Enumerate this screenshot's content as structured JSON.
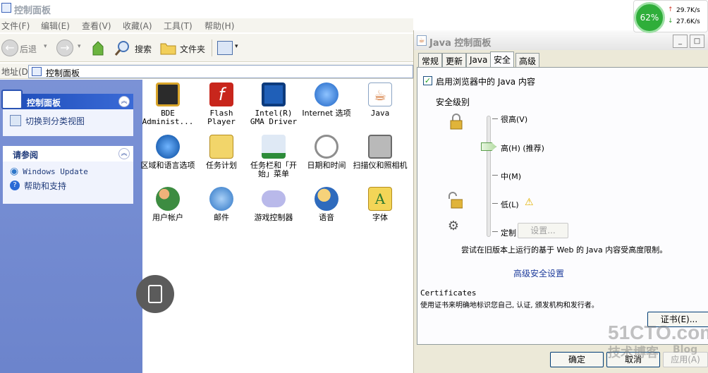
{
  "explorer": {
    "title": "控制面板",
    "menu": [
      "文件(F)",
      "编辑(E)",
      "查看(V)",
      "收藏(A)",
      "工具(T)",
      "帮助(H)"
    ],
    "toolbar": {
      "back_label": "后退",
      "search_label": "搜索",
      "folders_label": "文件夹"
    },
    "address": {
      "label": "地址(D)",
      "value": "控制面板"
    },
    "sidebar": {
      "panel1_title": "控制面板",
      "switch_view": "切换到分类视图",
      "panel2_title": "请参阅",
      "links": [
        "Windows Update",
        "帮助和支持"
      ]
    },
    "items": [
      {
        "label": "BDE Administ...",
        "icon": "bde-admin-icon",
        "color": "#d9a52a"
      },
      {
        "label": "Flash Player",
        "icon": "flash-icon",
        "color": "#c8261c"
      },
      {
        "label": "Intel(R) GMA Driver",
        "icon": "intel-gma-icon",
        "color": "#1f5fb8"
      },
      {
        "label": "Internet 选项",
        "icon": "internet-options-icon",
        "color": "#3d7fd6"
      },
      {
        "label": "Java",
        "icon": "java-icon",
        "color": "#cf6a24"
      },
      {
        "label": "区域和语言选项",
        "icon": "globe-icon",
        "color": "#2d76c9"
      },
      {
        "label": "任务计划",
        "icon": "scheduled-tasks-icon",
        "color": "#e2c04c"
      },
      {
        "label": "任务栏和「开始」菜单",
        "icon": "taskbar-icon",
        "color": "#2d8c3a"
      },
      {
        "label": "日期和时间",
        "icon": "clock-icon",
        "color": "#8e8e8e"
      },
      {
        "label": "扫描仪和照相机",
        "icon": "scanner-icon",
        "color": "#7b7b7b"
      },
      {
        "label": "用户帐户",
        "icon": "user-accounts-icon",
        "color": "#3d8c41"
      },
      {
        "label": "邮件",
        "icon": "mail-icon",
        "color": "#4b8bd1"
      },
      {
        "label": "游戏控制器",
        "icon": "gamepad-icon",
        "color": "#8b8bd0"
      },
      {
        "label": "语音",
        "icon": "speech-icon",
        "color": "#e3b23a"
      },
      {
        "label": "字体",
        "icon": "fonts-folder-icon",
        "color": "#e7c440"
      }
    ]
  },
  "java_dialog": {
    "title": "Java 控制面板",
    "tabs": [
      "常规",
      "更新",
      "Java",
      "安全",
      "高级"
    ],
    "active_tab": "安全",
    "enable_java_label": "启用浏览器中的 Java 内容",
    "security_level_label": "安全级别",
    "levels": [
      "很高(V)",
      "高(H) (推荐)",
      "中(M)",
      "低(L)",
      "定制"
    ],
    "settings_button": "设置...",
    "note": "尝试在旧版本上运行的基于 Web 的 Java 内容受高度限制。",
    "advanced_link": "高级安全设置",
    "certificates_title": "Certificates",
    "certificates_desc": "使用证书来明确地标识您自己, 认证, 颁发机构和发行者。",
    "certificates_button": "证书(E)...",
    "ok_button": "确定",
    "cancel_button": "取消",
    "apply_button": "应用(A)"
  },
  "net_status": {
    "percent": "62%",
    "up": "29.7K/s",
    "down": "27.6K/s"
  },
  "watermark": {
    "line1": "51CTO.com",
    "line2": "技术博客",
    "line3": "Blog"
  }
}
